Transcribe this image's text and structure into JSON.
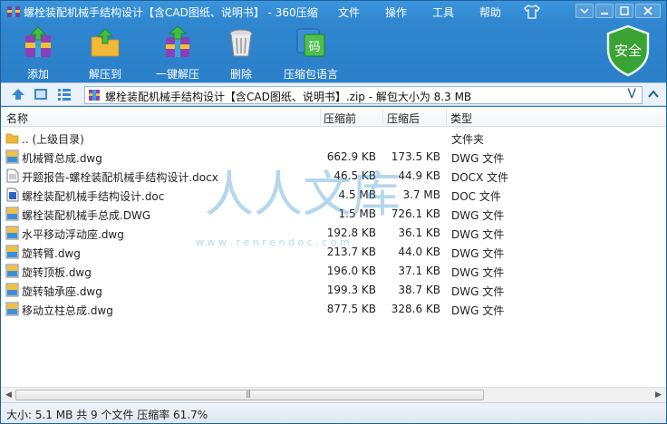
{
  "window": {
    "title": "螺栓装配机械手结构设计【含CAD图纸、说明书】 - 360压缩",
    "menu": [
      "文件",
      "操作",
      "工具",
      "帮助"
    ]
  },
  "toolbar": {
    "items": [
      {
        "label": "添加",
        "icon": "add-archive-icon"
      },
      {
        "label": "解压到",
        "icon": "extract-to-icon"
      },
      {
        "label": "一键解压",
        "icon": "one-click-extract-icon"
      },
      {
        "label": "删除",
        "icon": "trash-icon"
      },
      {
        "label": "压缩包语言",
        "icon": "archive-language-icon"
      }
    ],
    "language_glyph": "码",
    "security_badge": "安全"
  },
  "address": {
    "path": "螺栓装配机械手结构设计【含CAD图纸、说明书】.zip - 解包大小为 8.3 MB",
    "dropdown_glyph": "V"
  },
  "list": {
    "columns": {
      "name": "名称",
      "size": "压缩前",
      "packed": "压缩后",
      "type": "类型"
    },
    "rows": [
      {
        "name": ".. (上级目录)",
        "size": "",
        "packed": "",
        "type": "文件夹",
        "icon": "folder-icon"
      },
      {
        "name": "机械臂总成.dwg",
        "size": "662.9 KB",
        "packed": "173.5 KB",
        "type": "DWG 文件",
        "icon": "dwg-file-icon"
      },
      {
        "name": "开题报告-螺栓装配机械手结构设计.docx",
        "size": "46.5 KB",
        "packed": "44.9 KB",
        "type": "DOCX 文件",
        "icon": "docx-file-icon"
      },
      {
        "name": "螺栓装配机械手结构设计.doc",
        "size": "4.5 MB",
        "packed": "3.7 MB",
        "type": "DOC 文件",
        "icon": "doc-file-icon"
      },
      {
        "name": "螺栓装配机械手总成.DWG",
        "size": "1.5 MB",
        "packed": "726.1 KB",
        "type": "DWG 文件",
        "icon": "dwg-file-icon"
      },
      {
        "name": "水平移动浮动座.dwg",
        "size": "192.8 KB",
        "packed": "36.1 KB",
        "type": "DWG 文件",
        "icon": "dwg-file-icon"
      },
      {
        "name": "旋转臂.dwg",
        "size": "213.7 KB",
        "packed": "44.0 KB",
        "type": "DWG 文件",
        "icon": "dwg-file-icon"
      },
      {
        "name": "旋转顶板.dwg",
        "size": "196.0 KB",
        "packed": "37.1 KB",
        "type": "DWG 文件",
        "icon": "dwg-file-icon"
      },
      {
        "name": "旋转轴承座.dwg",
        "size": "199.3 KB",
        "packed": "38.7 KB",
        "type": "DWG 文件",
        "icon": "dwg-file-icon"
      },
      {
        "name": "移动立柱总成.dwg",
        "size": "877.5 KB",
        "packed": "328.6 KB",
        "type": "DWG 文件",
        "icon": "dwg-file-icon"
      }
    ]
  },
  "watermark": {
    "text": "人人文库",
    "url": "w w w . r e n r e n d o c . c o m"
  },
  "status": "大小: 5.1 MB 共 9 个文件 压缩率 61.7%"
}
